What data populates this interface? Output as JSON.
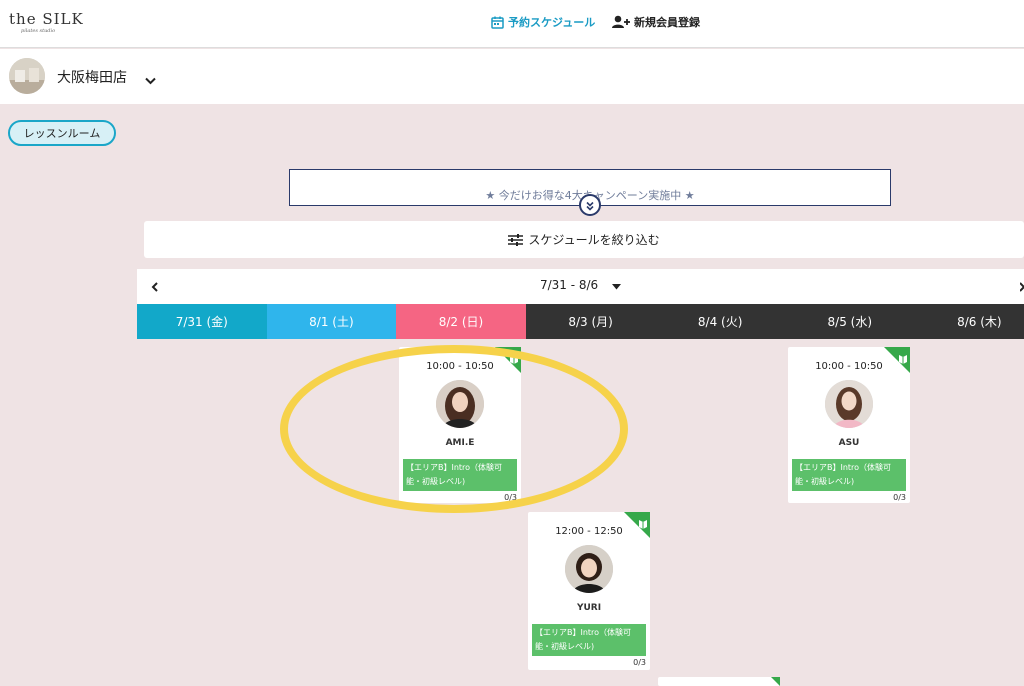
{
  "header": {
    "logo_main": "the SILK",
    "logo_sub": "pilates studio",
    "nav_schedule": "予約スケジュール",
    "nav_register": "新規会員登録"
  },
  "store": {
    "name": "大阪梅田店"
  },
  "room": {
    "label": "レッスンルーム"
  },
  "campaign": {
    "text": "★ 今だけお得な4大キャンペーン実施中 ★"
  },
  "filter": {
    "label": "スケジュールを絞り込む"
  },
  "week": {
    "range": "7/31 - 8/6"
  },
  "days": [
    {
      "label": "7/31 (金)",
      "color": "#12a8c9"
    },
    {
      "label": "8/1 (土)",
      "color": "#2fb5ec"
    },
    {
      "label": "8/2 (日)",
      "color": "#f56583"
    },
    {
      "label": "8/3 (月)",
      "color": "#333333"
    },
    {
      "label": "8/4 (火)",
      "color": "#333333"
    },
    {
      "label": "8/5 (水)",
      "color": "#333333"
    },
    {
      "label": "8/6 (木)",
      "color": "#333333"
    }
  ],
  "lessons": [
    {
      "time": "10:00 - 10:50",
      "instructor": "AMI.E",
      "tag": "【エリアB】Intro（体験可能・初級レベル)",
      "capacity": "0/3"
    },
    {
      "time": "10:00 - 10:50",
      "instructor": "ASU",
      "tag": "【エリアB】Intro（体験可能・初級レベル)",
      "capacity": "0/3"
    },
    {
      "time": "12:00 - 12:50",
      "instructor": "YURI",
      "tag": "【エリアB】Intro（体験可能・初級レベル)",
      "capacity": "0/3"
    }
  ],
  "colors": {
    "accent": "#1a9bc4",
    "tag_green": "#5cc06a",
    "highlight": "#f6d24a"
  }
}
